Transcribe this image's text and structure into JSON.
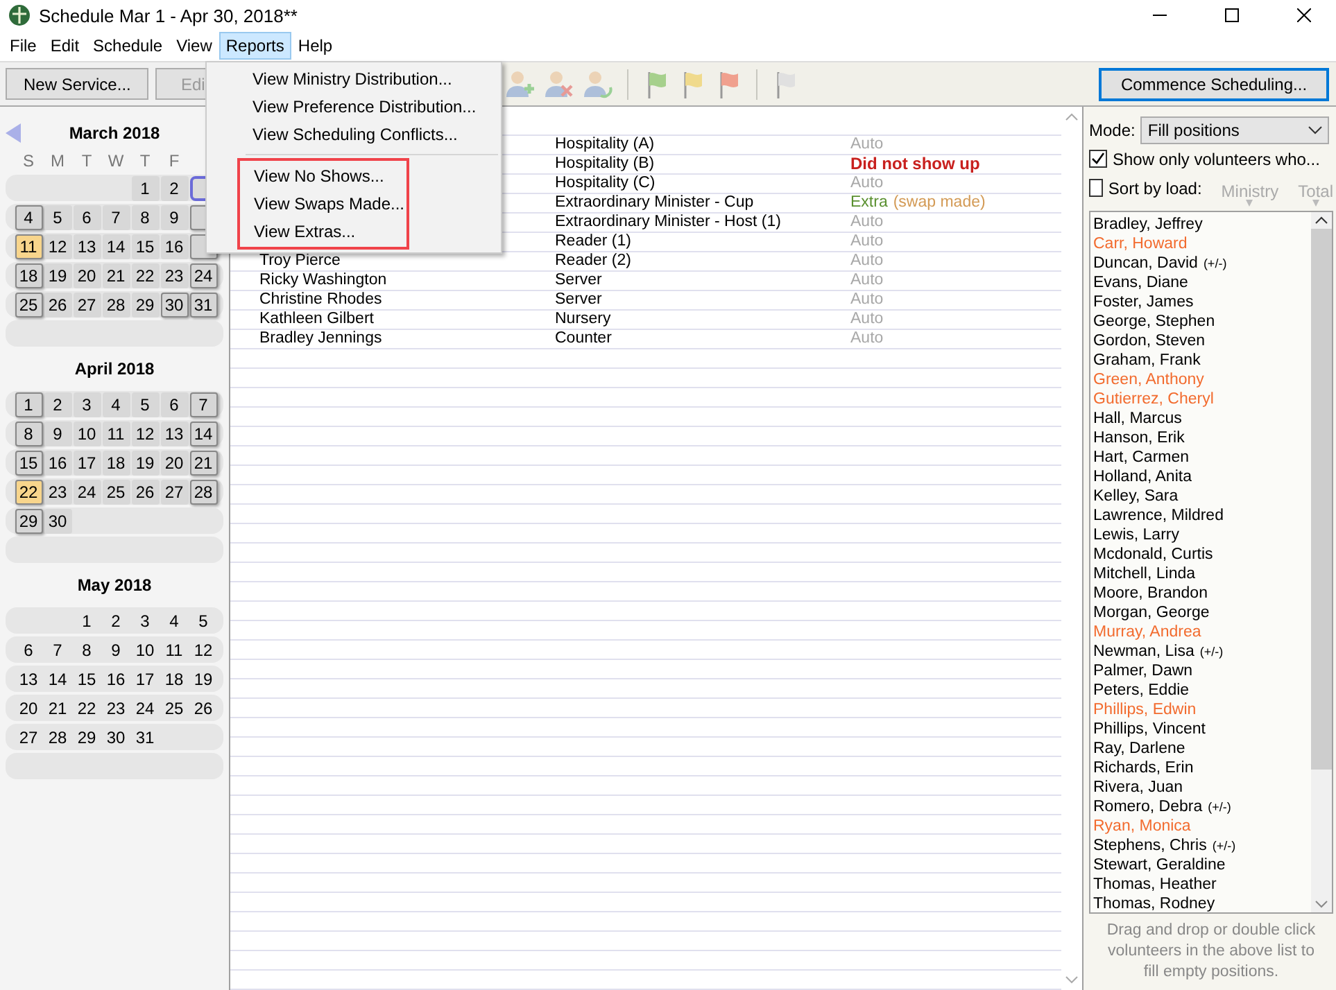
{
  "window": {
    "title": "Schedule Mar 1 - Apr 30, 2018**"
  },
  "menu": [
    {
      "label": "File",
      "selected": false
    },
    {
      "label": "Edit",
      "selected": false
    },
    {
      "label": "Schedule",
      "selected": false
    },
    {
      "label": "View",
      "selected": false
    },
    {
      "label": "Reports",
      "selected": true
    },
    {
      "label": "Help",
      "selected": false
    }
  ],
  "dropdown": {
    "sections": [
      {
        "highlighted": false,
        "items": [
          "View Ministry Distribution...",
          "View Preference Distribution...",
          "View Scheduling Conflicts..."
        ]
      },
      {
        "highlighted": true,
        "items": [
          "View No Shows...",
          "View Swaps Made...",
          "View Extras..."
        ]
      }
    ]
  },
  "toolbar": {
    "buttons": [
      {
        "label": "New Service...",
        "disabled": false
      },
      {
        "label": "Edi",
        "disabled": true
      }
    ],
    "icons": [
      {
        "kind": "person-add",
        "disabled": true
      },
      {
        "kind": "person-remove",
        "disabled": true
      },
      {
        "kind": "person-swap",
        "disabled": true
      },
      {
        "kind": "sep"
      },
      {
        "kind": "flag",
        "color": "#a6d08c"
      },
      {
        "kind": "flag",
        "color": "#f0da8c"
      },
      {
        "kind": "flag",
        "color": "#f0a08e"
      },
      {
        "kind": "sep"
      },
      {
        "kind": "flag",
        "color": "#e0e0e0"
      }
    ],
    "commence": "Commence Scheduling..."
  },
  "calendar": {
    "weekdays": [
      "S",
      "M",
      "T",
      "W",
      "T",
      "F"
    ],
    "months": [
      {
        "title": "March 2018",
        "weeks": [
          [
            {
              "kind": "blank"
            },
            {
              "kind": "blank"
            },
            {
              "kind": "blank"
            },
            {
              "kind": "blank"
            },
            {
              "d": "1",
              "kind": "range"
            },
            {
              "d": "2",
              "kind": "range"
            },
            {
              "kind": "current"
            }
          ],
          [
            {
              "d": "4",
              "kind": "service"
            },
            {
              "d": "5",
              "kind": "range"
            },
            {
              "d": "6",
              "kind": "range"
            },
            {
              "d": "7",
              "kind": "range"
            },
            {
              "d": "8",
              "kind": "range"
            },
            {
              "d": "9",
              "kind": "range"
            },
            {
              "kind": "service"
            }
          ],
          [
            {
              "d": "11",
              "kind": "marked"
            },
            {
              "d": "12",
              "kind": "range"
            },
            {
              "d": "13",
              "kind": "range"
            },
            {
              "d": "14",
              "kind": "range"
            },
            {
              "d": "15",
              "kind": "range"
            },
            {
              "d": "16",
              "kind": "range"
            },
            {
              "kind": "service"
            }
          ],
          [
            {
              "d": "18",
              "kind": "service"
            },
            {
              "d": "19",
              "kind": "range"
            },
            {
              "d": "20",
              "kind": "range"
            },
            {
              "d": "21",
              "kind": "range"
            },
            {
              "d": "22",
              "kind": "range"
            },
            {
              "d": "23",
              "kind": "range"
            },
            {
              "d": "24",
              "kind": "service"
            }
          ],
          [
            {
              "d": "25",
              "kind": "service"
            },
            {
              "d": "26",
              "kind": "range"
            },
            {
              "d": "27",
              "kind": "range"
            },
            {
              "d": "28",
              "kind": "range"
            },
            {
              "d": "29",
              "kind": "range"
            },
            {
              "d": "30",
              "kind": "service"
            },
            {
              "d": "31",
              "kind": "service"
            }
          ]
        ]
      },
      {
        "title": "April 2018",
        "weeks": [
          [
            {
              "d": "1",
              "kind": "service"
            },
            {
              "d": "2",
              "kind": "range"
            },
            {
              "d": "3",
              "kind": "range"
            },
            {
              "d": "4",
              "kind": "range"
            },
            {
              "d": "5",
              "kind": "range"
            },
            {
              "d": "6",
              "kind": "range"
            },
            {
              "d": "7",
              "kind": "service"
            }
          ],
          [
            {
              "d": "8",
              "kind": "service"
            },
            {
              "d": "9",
              "kind": "range"
            },
            {
              "d": "10",
              "kind": "range"
            },
            {
              "d": "11",
              "kind": "range"
            },
            {
              "d": "12",
              "kind": "range"
            },
            {
              "d": "13",
              "kind": "range"
            },
            {
              "d": "14",
              "kind": "service"
            }
          ],
          [
            {
              "d": "15",
              "kind": "service"
            },
            {
              "d": "16",
              "kind": "range"
            },
            {
              "d": "17",
              "kind": "range"
            },
            {
              "d": "18",
              "kind": "range"
            },
            {
              "d": "19",
              "kind": "range"
            },
            {
              "d": "20",
              "kind": "range"
            },
            {
              "d": "21",
              "kind": "service"
            }
          ],
          [
            {
              "d": "22",
              "kind": "marked"
            },
            {
              "d": "23",
              "kind": "range"
            },
            {
              "d": "24",
              "kind": "range"
            },
            {
              "d": "25",
              "kind": "range"
            },
            {
              "d": "26",
              "kind": "range"
            },
            {
              "d": "27",
              "kind": "range"
            },
            {
              "d": "28",
              "kind": "service"
            }
          ],
          [
            {
              "d": "29",
              "kind": "service"
            },
            {
              "d": "30",
              "kind": "range"
            }
          ]
        ]
      },
      {
        "title": "May 2018",
        "weeks": [
          [
            {
              "kind": "blank"
            },
            {
              "kind": "blank"
            },
            {
              "d": "1",
              "kind": "plain"
            },
            {
              "d": "2",
              "kind": "plain"
            },
            {
              "d": "3",
              "kind": "plain"
            },
            {
              "d": "4",
              "kind": "plain"
            },
            {
              "d": "5",
              "kind": "plain"
            }
          ],
          [
            {
              "d": "6",
              "kind": "plain"
            },
            {
              "d": "7",
              "kind": "plain"
            },
            {
              "d": "8",
              "kind": "plain"
            },
            {
              "d": "9",
              "kind": "plain"
            },
            {
              "d": "10",
              "kind": "plain"
            },
            {
              "d": "11",
              "kind": "plain"
            },
            {
              "d": "12",
              "kind": "plain"
            }
          ],
          [
            {
              "d": "13",
              "kind": "plain"
            },
            {
              "d": "14",
              "kind": "plain"
            },
            {
              "d": "15",
              "kind": "plain"
            },
            {
              "d": "16",
              "kind": "plain"
            },
            {
              "d": "17",
              "kind": "plain"
            },
            {
              "d": "18",
              "kind": "plain"
            },
            {
              "d": "19",
              "kind": "plain"
            }
          ],
          [
            {
              "d": "20",
              "kind": "plain"
            },
            {
              "d": "21",
              "kind": "plain"
            },
            {
              "d": "22",
              "kind": "plain"
            },
            {
              "d": "23",
              "kind": "plain"
            },
            {
              "d": "24",
              "kind": "plain"
            },
            {
              "d": "25",
              "kind": "plain"
            },
            {
              "d": "26",
              "kind": "plain"
            }
          ],
          [
            {
              "d": "27",
              "kind": "plain"
            },
            {
              "d": "28",
              "kind": "plain"
            },
            {
              "d": "29",
              "kind": "plain"
            },
            {
              "d": "30",
              "kind": "plain"
            },
            {
              "d": "31",
              "kind": "plain"
            }
          ]
        ]
      }
    ]
  },
  "table": {
    "rows": [
      {
        "role": "Hospitality  (A)",
        "status": {
          "kind": "auto",
          "text": "Auto"
        }
      },
      {
        "role": "Hospitality  (B)",
        "status": {
          "kind": "no_show",
          "text": "Did not show up"
        }
      },
      {
        "role": "Hospitality  (C)",
        "status": {
          "kind": "auto",
          "text": "Auto"
        }
      },
      {
        "role": "Extraordinary Minister - Cup",
        "status": {
          "kind": "extra",
          "text": "Extra",
          "note": "(swap made)"
        }
      },
      {
        "role": "Extraordinary Minister - Host  (1)",
        "status": {
          "kind": "auto",
          "text": "Auto"
        }
      },
      {
        "role": "Reader  (1)",
        "status": {
          "kind": "auto",
          "text": "Auto"
        }
      },
      {
        "name": "Troy Pierce",
        "role": "Reader  (2)",
        "status": {
          "kind": "auto",
          "text": "Auto"
        }
      },
      {
        "name": "Ricky Washington",
        "role": "Server",
        "status": {
          "kind": "auto",
          "text": "Auto"
        }
      },
      {
        "name": "Christine Rhodes",
        "role": "Server",
        "status": {
          "kind": "auto",
          "text": "Auto"
        }
      },
      {
        "name": "Kathleen Gilbert",
        "role": "Nursery",
        "status": {
          "kind": "auto",
          "text": "Auto"
        }
      },
      {
        "name": "Bradley Jennings",
        "role": "Counter",
        "status": {
          "kind": "auto",
          "text": "Auto"
        }
      }
    ]
  },
  "panel": {
    "mode_label": "Mode:",
    "mode_value": "Fill positions",
    "show_only": {
      "label": "Show only volunteers who...",
      "checked": true
    },
    "sort": {
      "label": "Sort by load:",
      "checked": false,
      "options": [
        "Ministry",
        "Total"
      ]
    },
    "volunteers": [
      {
        "name": "Bradley, Jeffrey"
      },
      {
        "name": "Carr, Howard",
        "color": "#f26b2e"
      },
      {
        "name": "Duncan, David",
        "note": "(+/-)"
      },
      {
        "name": "Evans, Diane"
      },
      {
        "name": "Foster, James"
      },
      {
        "name": "George, Stephen"
      },
      {
        "name": "Gordon, Steven"
      },
      {
        "name": "Graham, Frank"
      },
      {
        "name": "Green, Anthony",
        "color": "#f26b2e"
      },
      {
        "name": "Gutierrez, Cheryl",
        "color": "#f26b2e"
      },
      {
        "name": "Hall, Marcus"
      },
      {
        "name": "Hanson, Erik"
      },
      {
        "name": "Hart, Carmen"
      },
      {
        "name": "Holland, Anita"
      },
      {
        "name": "Kelley, Sara"
      },
      {
        "name": "Lawrence, Mildred"
      },
      {
        "name": "Lewis, Larry"
      },
      {
        "name": "Mcdonald, Curtis"
      },
      {
        "name": "Mitchell, Linda"
      },
      {
        "name": "Moore, Brandon"
      },
      {
        "name": "Morgan, George"
      },
      {
        "name": "Murray, Andrea",
        "color": "#f26b2e"
      },
      {
        "name": "Newman, Lisa",
        "note": "(+/-)"
      },
      {
        "name": "Palmer, Dawn"
      },
      {
        "name": "Peters, Eddie"
      },
      {
        "name": "Phillips, Edwin",
        "color": "#f26b2e"
      },
      {
        "name": "Phillips, Vincent"
      },
      {
        "name": "Ray, Darlene"
      },
      {
        "name": "Richards, Erin"
      },
      {
        "name": "Rivera, Juan"
      },
      {
        "name": "Romero, Debra",
        "note": "(+/-)"
      },
      {
        "name": "Ryan, Monica",
        "color": "#f26b2e"
      },
      {
        "name": "Stephens, Chris",
        "note": "(+/-)"
      },
      {
        "name": "Stewart, Geraldine"
      },
      {
        "name": "Thomas, Heather"
      },
      {
        "name": "Thomas, Rodney"
      }
    ],
    "hint": "Drag and drop or double click volunteers in the above list to fill empty positions."
  }
}
